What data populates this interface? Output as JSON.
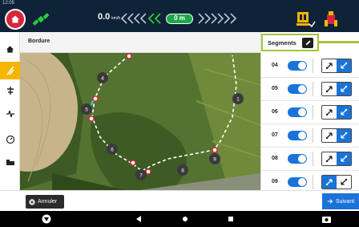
{
  "status_bar": {
    "time": "12:05"
  },
  "top_bar": {
    "speed_value": "0.0",
    "speed_unit": "km/h",
    "distance": "0 m"
  },
  "main": {
    "title": "Bordure"
  },
  "panel": {
    "title": "Segments",
    "rows": [
      {
        "number": "04",
        "enabled": true,
        "direction": "reverse"
      },
      {
        "number": "05",
        "enabled": true,
        "direction": "reverse"
      },
      {
        "number": "06",
        "enabled": true,
        "direction": "reverse"
      },
      {
        "number": "07",
        "enabled": true,
        "direction": "reverse"
      },
      {
        "number": "08",
        "enabled": true,
        "direction": "reverse"
      },
      {
        "number": "09",
        "enabled": true,
        "direction": "forward"
      }
    ]
  },
  "map": {
    "labels": [
      "1",
      "4",
      "5",
      "6",
      "7",
      "8",
      "9"
    ]
  },
  "footer": {
    "cancel_label": "Annuler",
    "next_label": "Suivant"
  },
  "colors": {
    "accent": "#1a73d9",
    "highlight": "#a4c639",
    "brand_red": "#d7263d",
    "nav_active": "#f7b500"
  }
}
